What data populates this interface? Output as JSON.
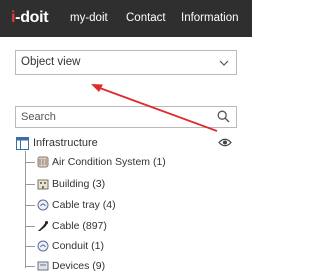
{
  "topbar": {
    "logo_i": "i",
    "logo_dash": "-",
    "logo_rest": "doit",
    "nav": [
      "my-doit",
      "Contact",
      "Information"
    ]
  },
  "object_view": {
    "selected": "Object view"
  },
  "search": {
    "placeholder": "Search"
  },
  "tree": {
    "root_label": "Infrastructure",
    "items": [
      {
        "label": "Air Condition System (1)",
        "icon": "aircon-icon"
      },
      {
        "label": "Building (3)",
        "icon": "building-icon"
      },
      {
        "label": "Cable tray (4)",
        "icon": "cable-tray-icon"
      },
      {
        "label": "Cable (897)",
        "icon": "cable-icon"
      },
      {
        "label": "Conduit (1)",
        "icon": "conduit-icon"
      },
      {
        "label": "Devices (9)",
        "icon": "devices-icon"
      }
    ]
  },
  "colors": {
    "topbar_bg": "#2f2f2f",
    "logo_accent": "#e33a34",
    "annotation_arrow": "#e02b2b"
  }
}
